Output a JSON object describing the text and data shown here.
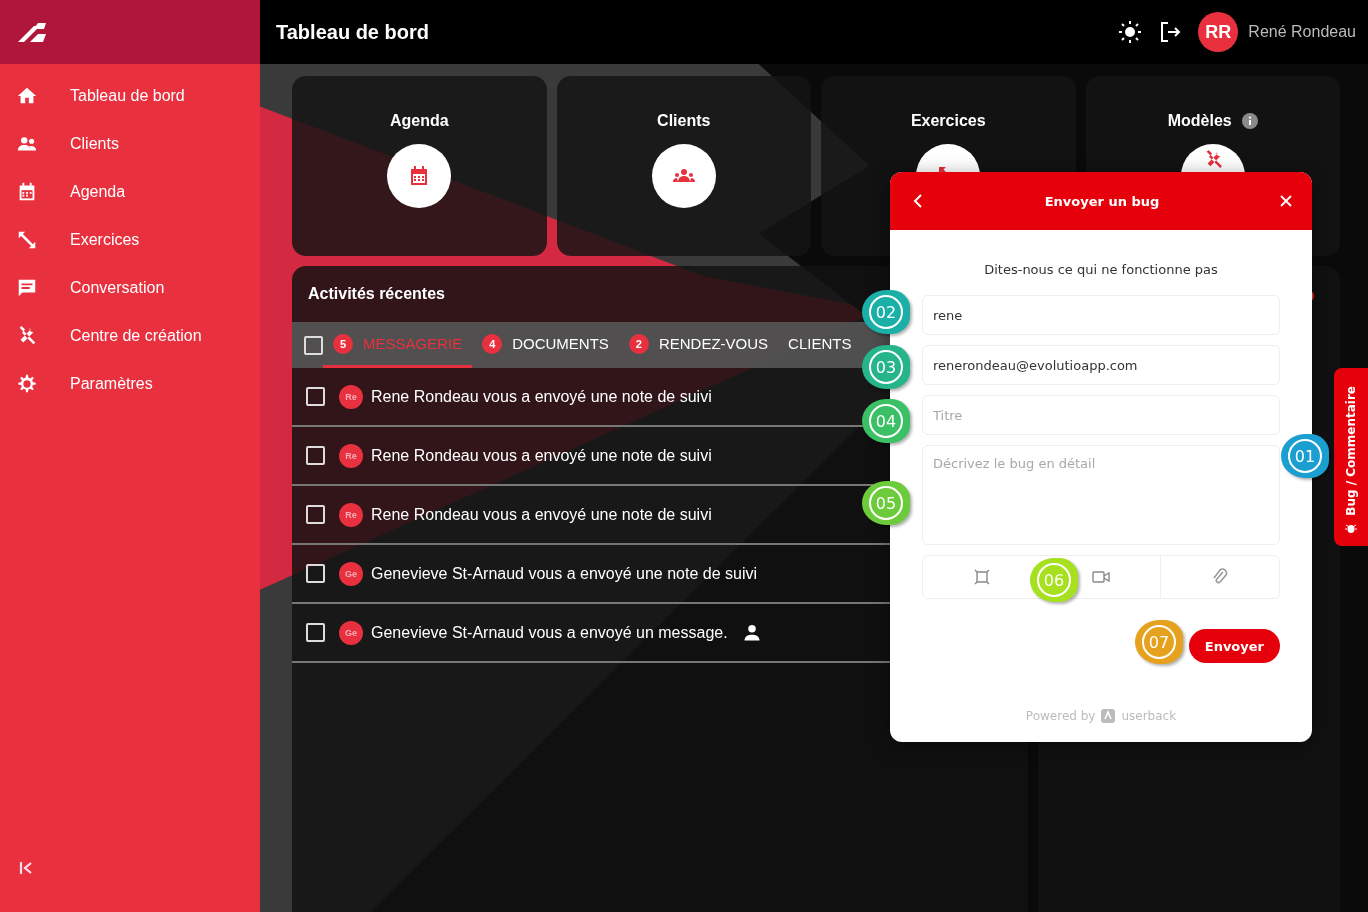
{
  "sidebar": {
    "items": [
      {
        "label": "Tableau de bord"
      },
      {
        "label": "Clients"
      },
      {
        "label": "Agenda"
      },
      {
        "label": "Exercices"
      },
      {
        "label": "Conversation"
      },
      {
        "label": "Centre de création"
      },
      {
        "label": "Paramètres"
      }
    ]
  },
  "header": {
    "title": "Tableau de bord",
    "user_initials": "RR",
    "user_name": "René Rondeau"
  },
  "shortcut_cards": [
    {
      "label": "Agenda",
      "info": false
    },
    {
      "label": "Clients",
      "info": false
    },
    {
      "label": "Exercices",
      "info": false
    },
    {
      "label": "Modèles",
      "info": true
    }
  ],
  "activity": {
    "title": "Activités récentes",
    "select_all_checked": false,
    "tabs": [
      {
        "label": "MESSAGERIE",
        "count": "5",
        "selected": true
      },
      {
        "label": "DOCUMENTS",
        "count": "4",
        "selected": false
      },
      {
        "label": "RENDEZ-VOUS",
        "count": "2",
        "selected": false
      },
      {
        "label": "CLIENTS",
        "selected": false
      }
    ],
    "rows": [
      {
        "initials": "Re",
        "text": "Rene Rondeau vous a envoyé une note de suivi",
        "checked": false,
        "user_icon": false
      },
      {
        "initials": "Re",
        "text": "Rene Rondeau vous a envoyé une note de suivi",
        "checked": false,
        "user_icon": false
      },
      {
        "initials": "Re",
        "text": "Rene Rondeau vous a envoyé une note de suivi",
        "checked": false,
        "user_icon": false
      },
      {
        "initials": "Ge",
        "text": "Genevieve St-Arnaud vous a envoyé une note de suivi",
        "checked": false,
        "user_icon": false
      },
      {
        "initials": "Ge",
        "text": "Genevieve St-Arnaud vous a envoyé un message.",
        "checked": false,
        "user_icon": true
      }
    ]
  },
  "bug_widget": {
    "title": "Envoyer un bug",
    "subtitle": "Dites-nous ce qui ne fonctionne pas",
    "name_value": "rene",
    "email_value": "renerondeau@evolutioapp.com",
    "title_placeholder": "Titre",
    "description_placeholder": "Décrivez le bug en détail",
    "send_label": "Envoyer",
    "powered_by": "Powered by",
    "brand": "userback",
    "side_tab": "Bug / Commentaire"
  },
  "callouts": [
    {
      "number": "01",
      "color": "#1a9fd0"
    },
    {
      "number": "02",
      "color": "#1ab0a8"
    },
    {
      "number": "03",
      "color": "#26b48a"
    },
    {
      "number": "04",
      "color": "#3cc065"
    },
    {
      "number": "05",
      "color": "#6ccb3a"
    },
    {
      "number": "06",
      "color": "#a6e01e"
    },
    {
      "number": "07",
      "color": "#e6a21e"
    }
  ]
}
